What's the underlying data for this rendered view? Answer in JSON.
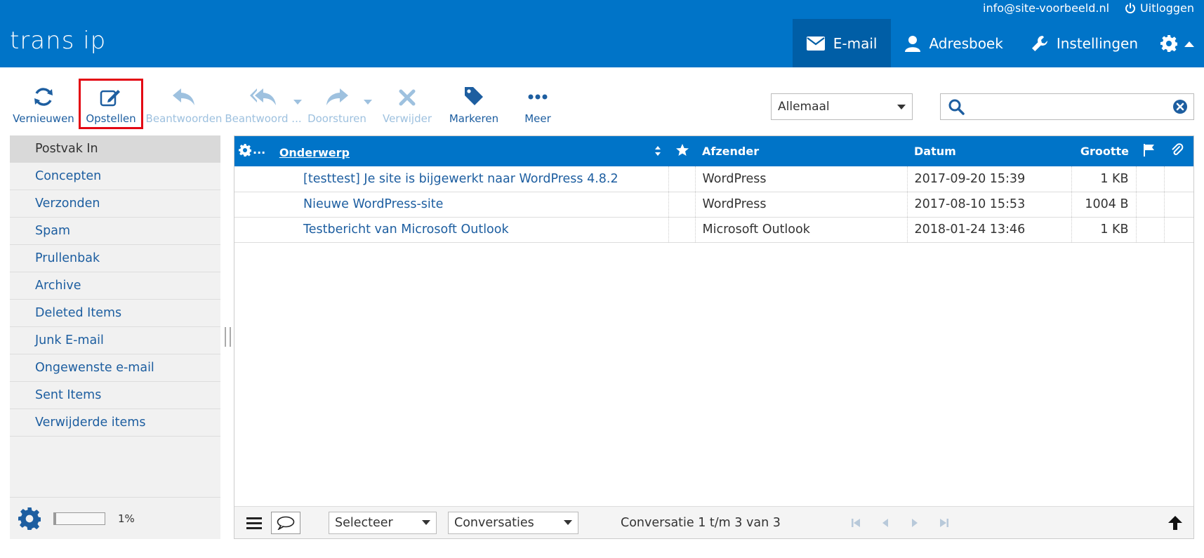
{
  "header": {
    "logo": "trans ip",
    "account_email": "info@site-voorbeeld.nl",
    "logout_label": "Uitloggen",
    "nav": [
      {
        "label": "E-mail",
        "icon": "envelope-icon",
        "active": true
      },
      {
        "label": "Adresboek",
        "icon": "person-icon",
        "active": false
      },
      {
        "label": "Instellingen",
        "icon": "wrench-icon",
        "active": false
      }
    ]
  },
  "toolbar": {
    "refresh": "Vernieuwen",
    "compose": "Opstellen",
    "reply": "Beantwoorden",
    "reply_all": "Beantwoord ...",
    "forward": "Doorsturen",
    "delete": "Verwijder",
    "mark": "Markeren",
    "more": "Meer"
  },
  "filter": {
    "selected": "Allemaal"
  },
  "search": {
    "value": "",
    "placeholder": ""
  },
  "folders": [
    {
      "label": "Postvak In",
      "selected": true
    },
    {
      "label": "Concepten"
    },
    {
      "label": "Verzonden"
    },
    {
      "label": "Spam"
    },
    {
      "label": "Prullenbak"
    },
    {
      "label": "Archive"
    },
    {
      "label": "Deleted Items"
    },
    {
      "label": "Junk E-mail"
    },
    {
      "label": "Ongewenste e-mail"
    },
    {
      "label": "Sent Items"
    },
    {
      "label": "Verwijderde items"
    }
  ],
  "quota": {
    "percent": 1,
    "label": "1%"
  },
  "list": {
    "columns": {
      "options": "...",
      "subject": "Onderwerp",
      "from": "Afzender",
      "date": "Datum",
      "size": "Grootte"
    },
    "messages": [
      {
        "subject": "[testtest] Je site is bijgewerkt naar WordPress 4.8.2",
        "from": "WordPress",
        "date": "2017-09-20 15:39",
        "size": "1 KB"
      },
      {
        "subject": "Nieuwe WordPress-site",
        "from": "WordPress",
        "date": "2017-08-10 15:53",
        "size": "1004 B"
      },
      {
        "subject": "Testbericht van Microsoft Outlook",
        "from": "Microsoft Outlook",
        "date": "2018-01-24 13:46",
        "size": "1 KB"
      }
    ],
    "footer": {
      "select_label": "Selecteer",
      "threads_label": "Conversaties",
      "count_text": "Conversatie 1 t/m 3 van 3"
    }
  },
  "colors": {
    "brand": "#0074c8",
    "brand_dark": "#005ea6",
    "link": "#1d5ea0",
    "highlight": "#e30613"
  }
}
